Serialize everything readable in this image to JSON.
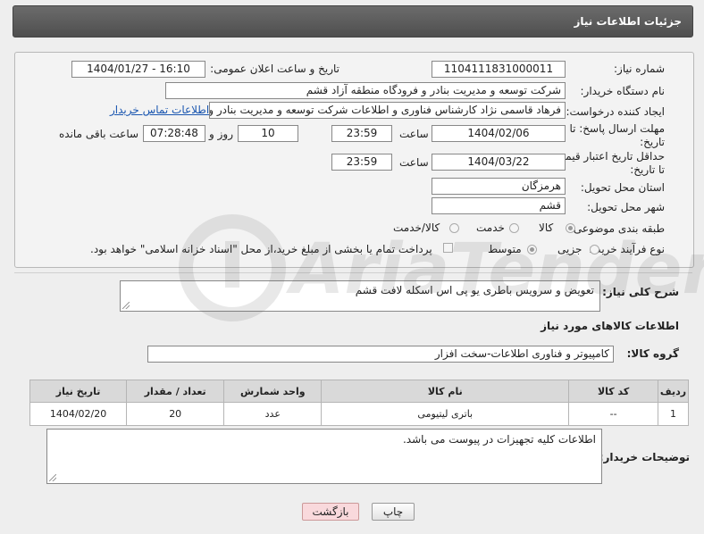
{
  "header": {
    "title": "جزئیات اطلاعات نیاز"
  },
  "fields": {
    "need_number_label": "شماره نیاز:",
    "need_number": "1104111831000011",
    "announce_label": "تاریخ و ساعت اعلان عمومی:",
    "announce_value": "1404/01/27 - 16:10",
    "buyer_org_label": "نام دستگاه خریدار:",
    "buyer_org": "شرکت توسعه و مدیریت بنادر و فرودگاه منطقه آزاد قشم",
    "creator_label": "ایجاد کننده درخواست:",
    "creator": "فرهاد قاسمی نژاد کارشناس فناوری و اطلاعات شرکت توسعه و مدیریت بنادر و ف",
    "contact_link": "اطلاعات تماس خریدار",
    "deadline_label_1": "مهلت ارسال پاسخ: تا",
    "deadline_label_2": "تاریخ:",
    "deadline_date": "1404/02/06",
    "time_label": "ساعت",
    "deadline_time": "23:59",
    "days_value": "10",
    "days_label": "روز و",
    "remaining_value": "07:28:48",
    "remaining_label": "ساعت باقی مانده",
    "validity_label_1": "حداقل تاریخ اعتبار قیمت:",
    "validity_label_2": "تا تاریخ:",
    "validity_date": "1404/03/22",
    "validity_time": "23:59",
    "province_label": "استان محل تحویل:",
    "province": "هرمزگان",
    "city_label": "شهر محل تحویل:",
    "city": "قشم",
    "category_label": "طبقه بندی موضوعی:",
    "category_options": [
      "کالا",
      "خدمت",
      "کالا/خدمت"
    ],
    "category_selected": "کالا",
    "process_label": "نوع فرآیند خرید :",
    "process_options": [
      "جزیی",
      "متوسط"
    ],
    "process_selected": "متوسط",
    "payment_note": "پرداخت تمام یا بخشی از مبلغ خرید،از محل \"اسناد خزانه اسلامی\" خواهد بود."
  },
  "description": {
    "label": "شرح کلی نیاز:",
    "value": "تعویض و سرویس باطری یو پی اس اسکله لافت قشم"
  },
  "goods_section": {
    "title": "اطلاعات کالاهای مورد نیاز",
    "group_label": "گروه کالا:",
    "group_value": "کامپیوتر و فناوری اطلاعات-سخت افزار"
  },
  "table": {
    "headers": [
      "ردیف",
      "کد کالا",
      "نام کالا",
      "واحد شمارش",
      "تعداد / مقدار",
      "تاریخ نیاز"
    ],
    "rows": [
      [
        "1",
        "--",
        "باتری لیتیومی",
        "عدد",
        "20",
        "1404/02/20"
      ]
    ]
  },
  "buyer_notes": {
    "label": "توضیحات خریدار:",
    "value": "اطلاعات کلیه تجهیزات  در پیوست می باشد."
  },
  "buttons": {
    "print": "چاپ",
    "back": "بازگشت"
  },
  "watermark": {
    "text": "AriaTender.neT"
  }
}
